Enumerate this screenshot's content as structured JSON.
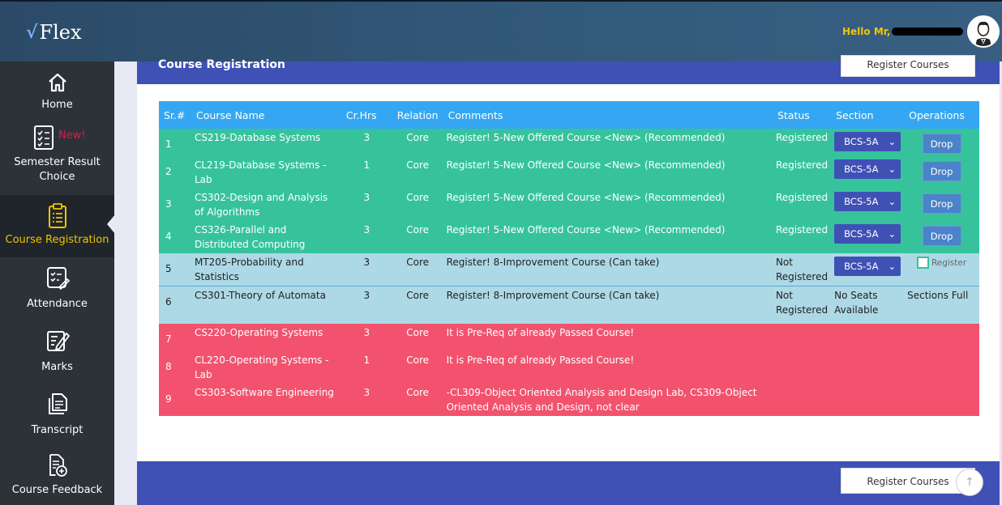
{
  "header": {
    "logo_text": "Flex",
    "greeting": "Hello Mr,"
  },
  "sidebar": {
    "items": [
      {
        "label": "Home",
        "icon": "home-icon"
      },
      {
        "label": "Semester Result Choice",
        "icon": "checklist-icon",
        "badge": "New!"
      },
      {
        "label": "Course Registration",
        "icon": "clipboard-list-icon",
        "active": true
      },
      {
        "label": "Attendance",
        "icon": "attendance-icon"
      },
      {
        "label": "Marks",
        "icon": "edit-note-icon"
      },
      {
        "label": "Transcript",
        "icon": "document-stack-icon"
      },
      {
        "label": "Course Feedback",
        "icon": "document-plus-icon"
      }
    ]
  },
  "page": {
    "title": "Course Registration",
    "register_top_label": "Register Courses",
    "register_bottom_label": "Register Courses",
    "scroll_top_icon": "arrow-up-icon"
  },
  "table": {
    "columns": [
      "Sr.#",
      "Course Name",
      "Cr.Hrs",
      "Relation",
      "Comments",
      "Status",
      "Section",
      "Operations"
    ],
    "rows": [
      {
        "sr": "1",
        "course": "CS219-Database Systems",
        "hrs": "3",
        "rel": "Core",
        "comment": "Register! 5-New Offered Course <New> (Recommended)",
        "status": "Registered",
        "section": "BCS-5A",
        "op": "Drop"
      },
      {
        "sr": "2",
        "course": "CL219-Database Systems - Lab",
        "hrs": "1",
        "rel": "Core",
        "comment": "Register! 5-New Offered Course <New> (Recommended)",
        "status": "Registered",
        "section": "BCS-5A",
        "op": "Drop"
      },
      {
        "sr": "3",
        "course": "CS302-Design and Analysis of Algorithms",
        "hrs": "3",
        "rel": "Core",
        "comment": "Register! 5-New Offered Course <New> (Recommended)",
        "status": "Registered",
        "section": "BCS-5A",
        "op": "Drop"
      },
      {
        "sr": "4",
        "course": "CS326-Parallel and Distributed Computing",
        "hrs": "3",
        "rel": "Core",
        "comment": "Register! 5-New Offered Course <New> (Recommended)",
        "status": "Registered",
        "section": "BCS-5A",
        "op": "Drop"
      },
      {
        "sr": "5",
        "course": "MT205-Probability and Statistics",
        "hrs": "3",
        "rel": "Core",
        "comment": "Register! 8-Improvement Course (Can take)",
        "status": "Not Registered",
        "section": "BCS-5A",
        "op": "Register"
      },
      {
        "sr": "6",
        "course": "CS301-Theory of Automata",
        "hrs": "3",
        "rel": "Core",
        "comment": "Register! 8-Improvement Course (Can take)",
        "status": "Not Registered",
        "section": "No Seats Available",
        "op": "Sections Full"
      },
      {
        "sr": "7",
        "course": "CS220-Operating Systems",
        "hrs": "3",
        "rel": "Core",
        "comment": "It is Pre-Req of already Passed Course!",
        "status": "",
        "section": "",
        "op": ""
      },
      {
        "sr": "8",
        "course": "CL220-Operating Systems - Lab",
        "hrs": "1",
        "rel": "Core",
        "comment": "It is Pre-Req of already Passed Course!",
        "status": "",
        "section": "",
        "op": ""
      },
      {
        "sr": "9",
        "course": "CS303-Software Engineering",
        "hrs": "3",
        "rel": "Core",
        "comment": "-CL309-Object Oriented Analysis and Design Lab, CS309-Object Oriented Analysis and Design, not clear",
        "status": "",
        "section": "",
        "op": ""
      }
    ]
  },
  "colors": {
    "header_bg": "#2b4a67",
    "sidebar_bg": "#2c3238",
    "accent": "#3f51b5",
    "table_head": "#35a7f2",
    "row_registered": "#36c39c",
    "row_can_take": "#add9e6",
    "row_blocked": "#f2526d",
    "greeting": "#f0c400"
  }
}
